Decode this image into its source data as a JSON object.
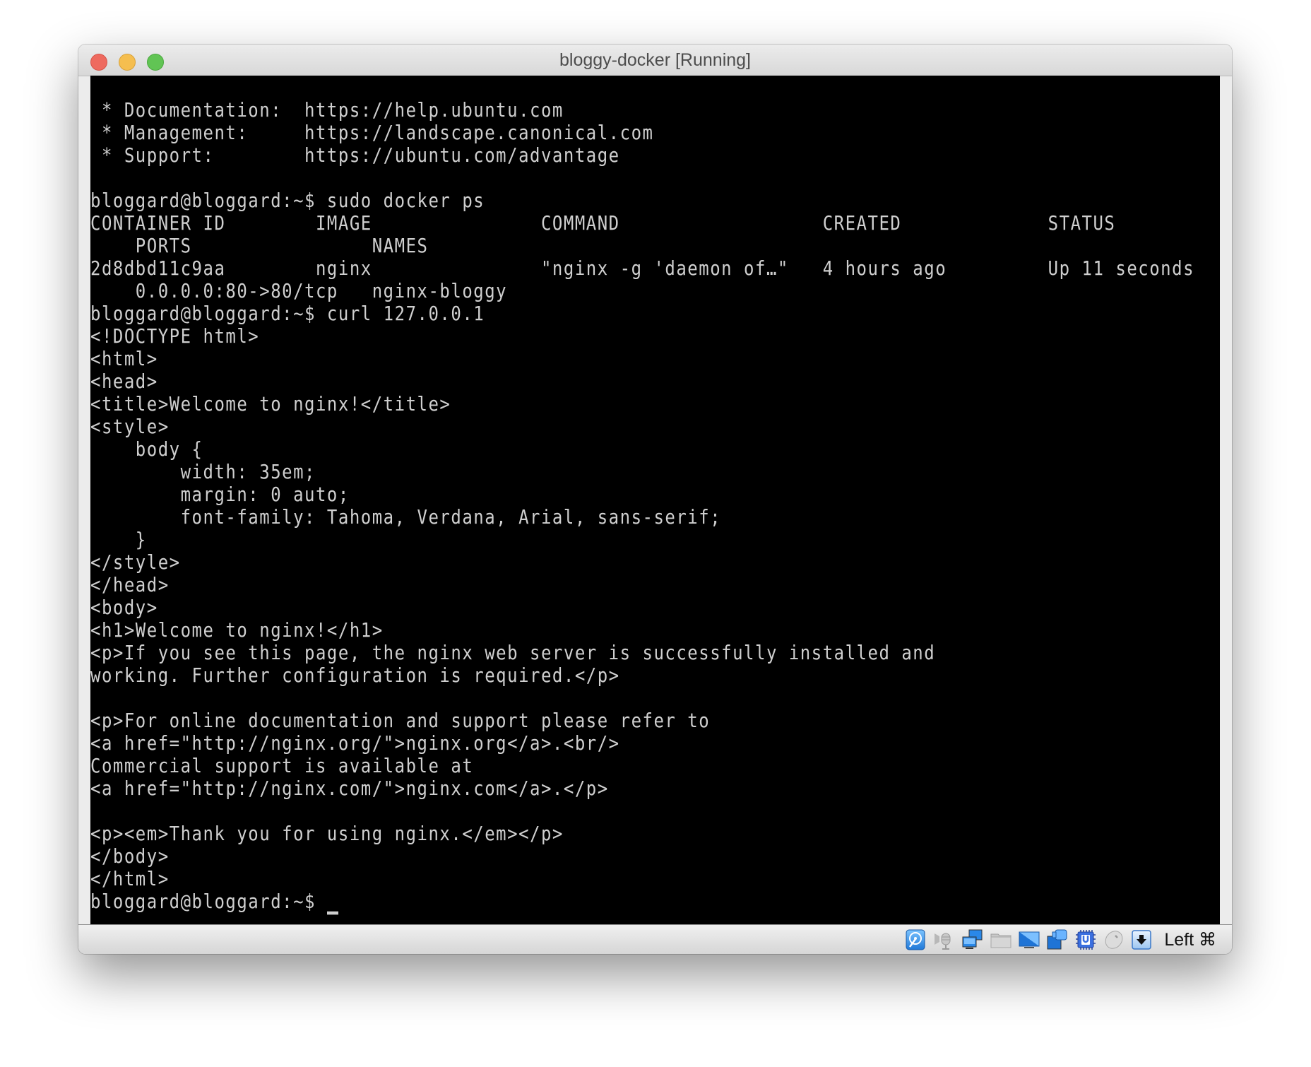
{
  "window": {
    "title": "bloggy-docker [Running]",
    "controls": [
      "close",
      "minimize",
      "zoom"
    ]
  },
  "terminal": {
    "lines": [
      " * Documentation:  https://help.ubuntu.com",
      " * Management:     https://landscape.canonical.com",
      " * Support:        https://ubuntu.com/advantage",
      "",
      "bloggard@bloggard:~$ sudo docker ps",
      "CONTAINER ID        IMAGE               COMMAND                  CREATED             STATUS",
      "    PORTS                NAMES",
      "2d8dbd11c9aa        nginx               \"nginx -g 'daemon of…\"   4 hours ago         Up 11 seconds",
      "    0.0.0.0:80->80/tcp   nginx-bloggy",
      "bloggard@bloggard:~$ curl 127.0.0.1",
      "<!DOCTYPE html>",
      "<html>",
      "<head>",
      "<title>Welcome to nginx!</title>",
      "<style>",
      "    body {",
      "        width: 35em;",
      "        margin: 0 auto;",
      "        font-family: Tahoma, Verdana, Arial, sans-serif;",
      "    }",
      "</style>",
      "</head>",
      "<body>",
      "<h1>Welcome to nginx!</h1>",
      "<p>If you see this page, the nginx web server is successfully installed and",
      "working. Further configuration is required.</p>",
      "",
      "<p>For online documentation and support please refer to",
      "<a href=\"http://nginx.org/\">nginx.org</a>.<br/>",
      "Commercial support is available at",
      "<a href=\"http://nginx.com/\">nginx.com</a>.</p>",
      "",
      "<p><em>Thank you for using nginx.</em></p>",
      "</body>",
      "</html>",
      "bloggard@bloggard:~$ "
    ],
    "prompt": "bloggard@bloggard:~$",
    "colors": {
      "background": "#000000",
      "foreground": "#cfcfcf"
    }
  },
  "statusbar": {
    "icons": [
      {
        "name": "hard-disk-icon",
        "label": "Hard Disks"
      },
      {
        "name": "audio-icon",
        "label": "Audio"
      },
      {
        "name": "network-icon",
        "label": "Network"
      },
      {
        "name": "shared-folders-icon",
        "label": "Shared Folders"
      },
      {
        "name": "display-icon",
        "label": "Display"
      },
      {
        "name": "video-capture-icon",
        "label": "Video Capture"
      },
      {
        "name": "cpu-virtualization-icon",
        "label": "VT-x"
      },
      {
        "name": "mouse-integration-icon",
        "label": "Mouse Integration"
      },
      {
        "name": "keyboard-capture-icon",
        "label": "Keyboard"
      }
    ],
    "host_key": "Left ⌘"
  }
}
